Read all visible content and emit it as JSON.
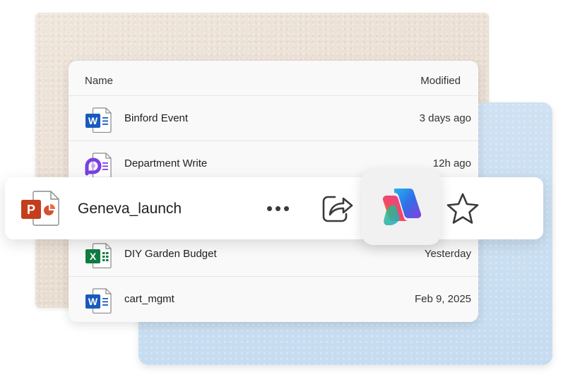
{
  "file_list": {
    "columns": {
      "name": "Name",
      "modified": "Modified"
    },
    "rows": [
      {
        "name": "Binford Event",
        "modified": "3 days ago",
        "icon": "word-icon"
      },
      {
        "name": "Department Write",
        "modified": "12h ago",
        "icon": "loop-icon"
      },
      {
        "name": "DIY Garden Budget",
        "modified": "Yesterday",
        "icon": "excel-icon"
      },
      {
        "name": "cart_mgmt",
        "modified": "Feb 9, 2025",
        "icon": "word-icon"
      }
    ]
  },
  "selected_file": {
    "name": "Geneva_launch",
    "icon": "powerpoint-icon",
    "actions": [
      "more-options-icon",
      "share-icon",
      "copilot-icon",
      "star-icon"
    ]
  },
  "icon_letters": {
    "word": "W",
    "excel": "X",
    "powerpoint": "P"
  },
  "colors": {
    "word": "#185abd",
    "excel": "#107c41",
    "powerpoint": "#c43e1c",
    "loop": "#7b3fe4",
    "beige_bg": "#ebe1d5",
    "blue_bg": "#cbdff1"
  }
}
